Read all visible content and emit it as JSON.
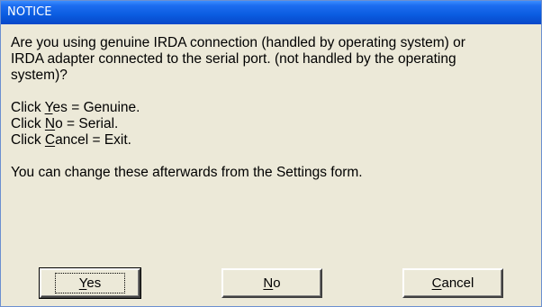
{
  "window": {
    "title": "NOTICE"
  },
  "message": {
    "paragraph1": "Are you using genuine IRDA connection  (handled by operating system) or\nIRDA adapter connected to the serial port. (not handled by the operating\nsystem)?",
    "line_yes": {
      "prefix": "Click ",
      "accel": "Y",
      "rest": "es = Genuine."
    },
    "line_no": {
      "prefix": "Click ",
      "accel": "N",
      "rest": "o = Serial."
    },
    "line_cancel": {
      "prefix": "Click ",
      "accel": "C",
      "rest": "ancel = Exit."
    },
    "paragraph3": "You can change these afterwards from the Settings form."
  },
  "buttons": {
    "yes": {
      "accel": "Y",
      "rest": "es"
    },
    "no": {
      "accel": "N",
      "rest": "o"
    },
    "cancel": {
      "accel": "C",
      "rest": "ancel"
    }
  }
}
